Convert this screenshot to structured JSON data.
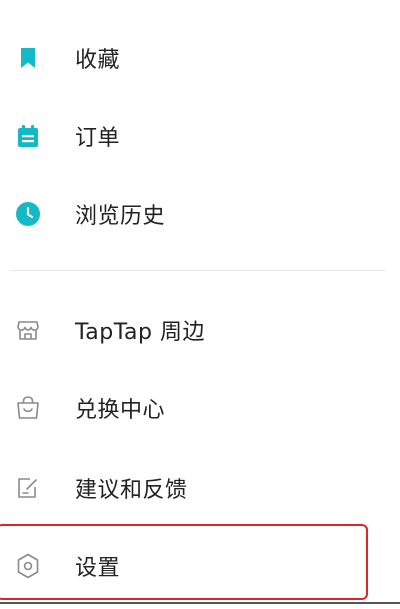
{
  "menu": {
    "items": [
      {
        "label": "收藏",
        "icon": "bookmark-icon"
      },
      {
        "label": "订单",
        "icon": "order-icon"
      },
      {
        "label": "浏览历史",
        "icon": "clock-icon"
      },
      {
        "label": "TapTap 周边",
        "icon": "store-icon"
      },
      {
        "label": "兑换中心",
        "icon": "gift-bag-icon"
      },
      {
        "label": "建议和反馈",
        "icon": "feedback-icon"
      },
      {
        "label": "设置",
        "icon": "settings-icon"
      }
    ]
  },
  "colors": {
    "accent": "#14b9c8",
    "outline": "#8a8a8a",
    "highlight": "#d9272e"
  }
}
